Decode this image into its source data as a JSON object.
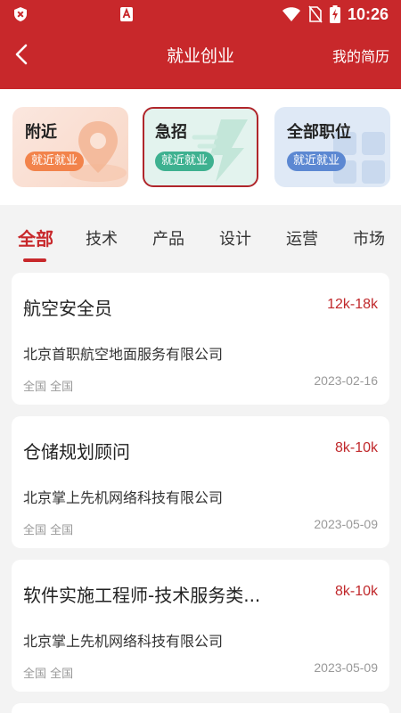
{
  "status_bar": {
    "time": "10:26",
    "left_icon": "shield-x-icon",
    "mid_icon": "alert-a-icon",
    "right_icons": [
      "wifi-icon",
      "no-sim-icon",
      "battery-charging-icon"
    ]
  },
  "navbar": {
    "title": "就业创业",
    "right_label": "我的简历",
    "back_icon": "back-arrow-icon"
  },
  "categories": [
    {
      "title": "附近",
      "pill": "就近就业"
    },
    {
      "title": "急招",
      "pill": "就近就业"
    },
    {
      "title": "全部职位",
      "pill": "就近就业"
    }
  ],
  "tabs": [
    "全部",
    "技术",
    "产品",
    "设计",
    "运营",
    "市场"
  ],
  "active_tab": "全部",
  "jobs": [
    {
      "title": "航空安全员",
      "salary": "12k-18k",
      "company": "北京首职航空地面服务有限公司",
      "location": "全国 全国",
      "date": "2023-02-16"
    },
    {
      "title": "仓储规划顾问",
      "salary": "8k-10k",
      "company": "北京掌上先机网络科技有限公司",
      "location": "全国 全国",
      "date": "2023-05-09"
    },
    {
      "title": "软件实施工程师-技术服务类...",
      "salary": "8k-10k",
      "company": "北京掌上先机网络科技有限公司",
      "location": "全国 全国",
      "date": "2023-05-09"
    }
  ],
  "colors": {
    "brand_red": "#c8282b",
    "salary_red": "#c0282b",
    "nearby_orange": "#f2834b",
    "urgent_green": "#3eb190",
    "all_blue": "#5c88d2"
  }
}
